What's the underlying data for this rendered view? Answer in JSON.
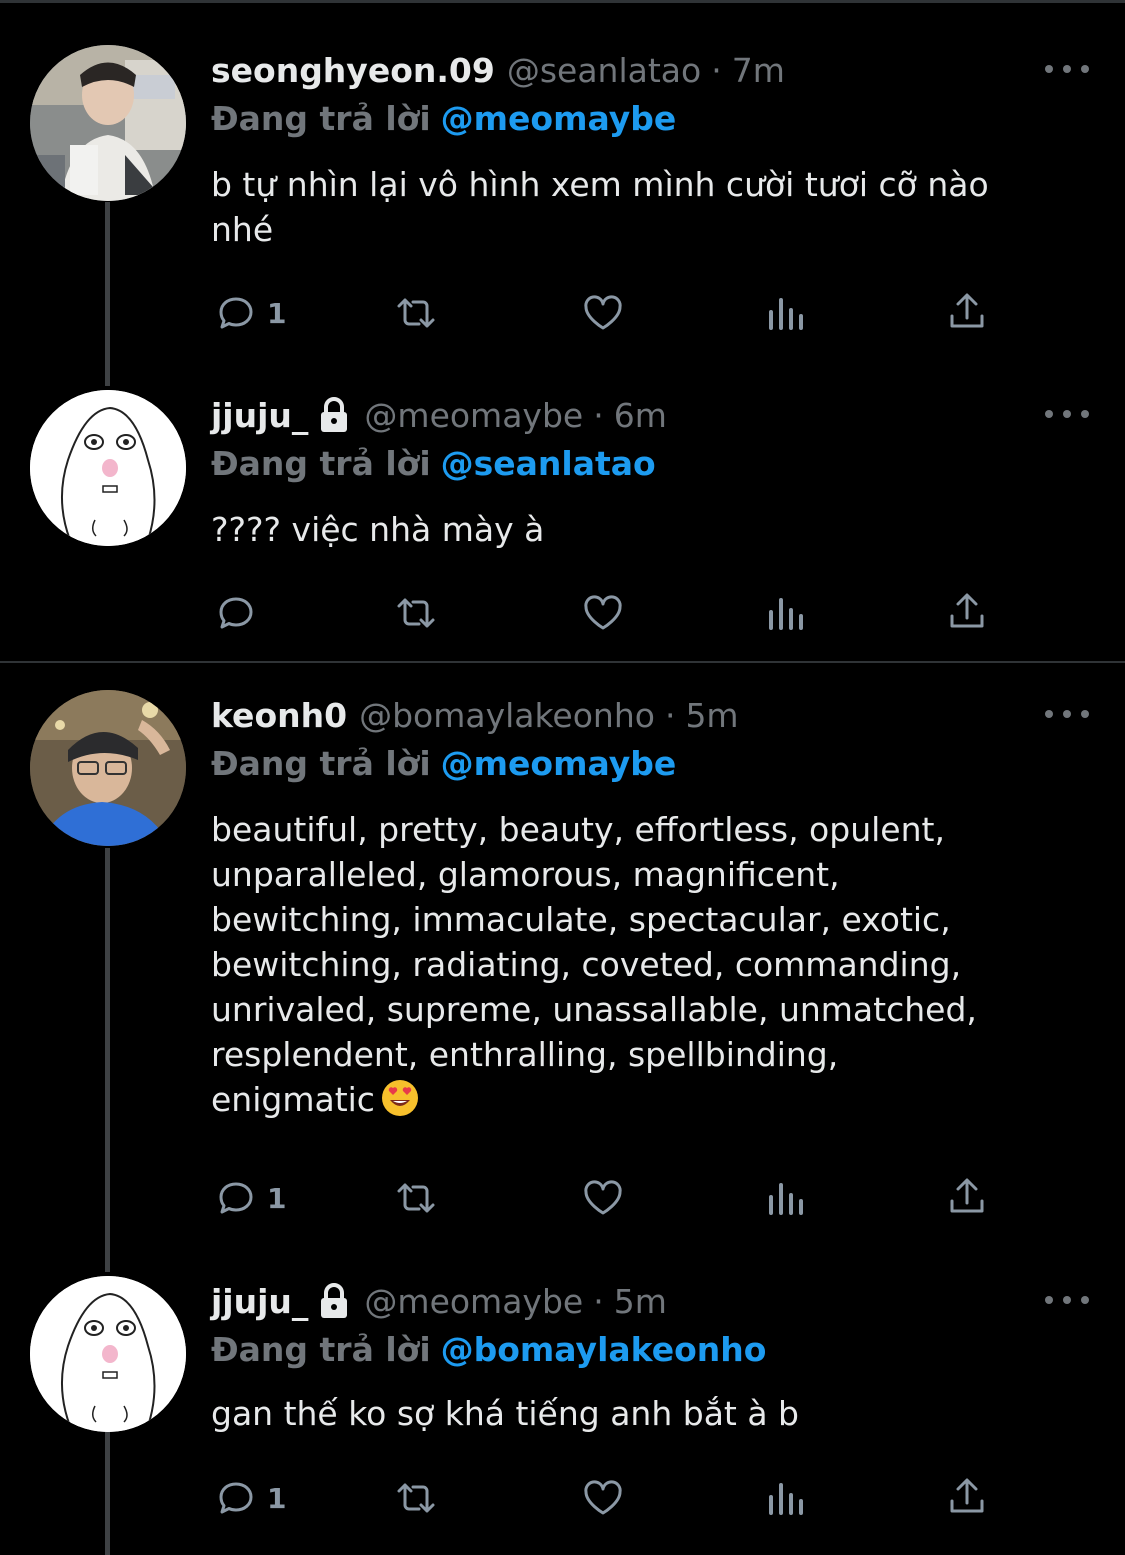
{
  "colors": {
    "background": "#000000",
    "primary_text": "#e7e9ea",
    "secondary_text": "#71767b",
    "mention": "#1d9bf0",
    "thread_line": "#3e4144",
    "divider": "#2f3336"
  },
  "tweets": [
    {
      "name": "seonghyeon.09",
      "locked": false,
      "handle": "@seanlatao",
      "dot": "·",
      "time": "7m",
      "reply_prefix": "Đang trả lời",
      "reply_to": "@meomaybe",
      "text": "b tự nhìn lại vô hình xem mình cười tươi cỡ nào\nnhé",
      "reply_count": "1",
      "avatar_icon": "photo-avatar"
    },
    {
      "name": "jjuju_",
      "locked": true,
      "handle": "@meomaybe",
      "dot": "·",
      "time": "6m",
      "reply_prefix": "Đang trả lời",
      "reply_to": "@seanlatao",
      "text": "???? việc nhà mày à",
      "reply_count": "",
      "avatar_icon": "cartoon-avatar"
    },
    {
      "name": "keonh0",
      "locked": false,
      "handle": "@bomaylakeonho",
      "dot": "·",
      "time": "5m",
      "reply_prefix": "Đang trả lời",
      "reply_to": "@meomaybe",
      "text": "beautiful, pretty, beauty, effortless, opulent,\nunparalleled, glamorous, magnificent,\nbewitching, immaculate, spectacular, exotic,\nbewitching, radiating, coveted, commanding,\nunrivaled, supreme, unassallable, unmatched,\nresplendent, enthralling, spellbinding,\nenigmatic",
      "text_emoji": "heart-eyes-emoji",
      "reply_count": "1",
      "avatar_icon": "photo-avatar"
    },
    {
      "name": "jjuju_",
      "locked": true,
      "handle": "@meomaybe",
      "dot": "·",
      "time": "5m",
      "reply_prefix": "Đang trả lời",
      "reply_to": "@bomaylakeonho",
      "text": "gan thế ko sợ khá tiếng anh bắt à b",
      "reply_count": "1",
      "avatar_icon": "cartoon-avatar"
    }
  ]
}
